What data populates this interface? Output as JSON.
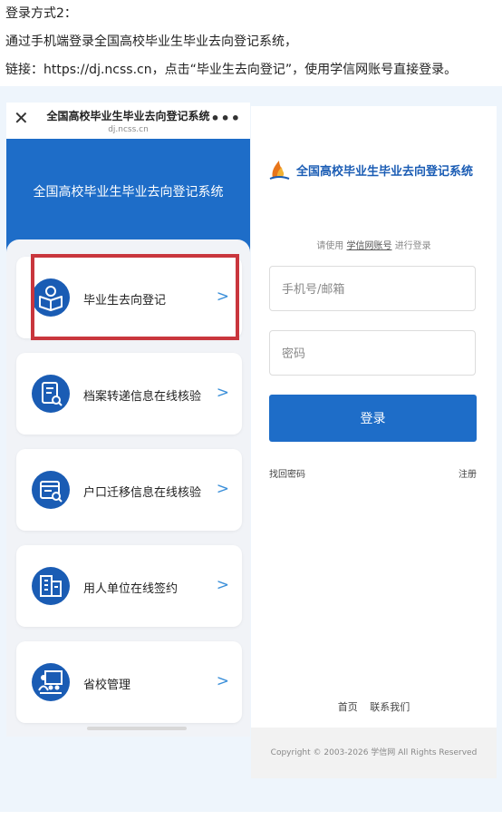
{
  "intro": {
    "line1": "登录方式2：",
    "line2": "通过手机端登录全国高校毕业生毕业去向登记系统，",
    "line3": "链接：https://dj.ncss.cn，点击“毕业生去向登记”，使用学信网账号直接登录。"
  },
  "left_phone": {
    "topbar": {
      "close_icon": "close-icon",
      "title": "全国高校毕业生毕业去向登记系统",
      "url": "dj.ncss.cn",
      "more_icon": "more-icon"
    },
    "hero_title": "全国高校毕业生毕业去向登记系统",
    "menu": [
      {
        "label": "毕业生去向登记",
        "icon": "book-reader-icon",
        "highlighted": true
      },
      {
        "label": "档案转递信息在线核验",
        "icon": "document-search-icon"
      },
      {
        "label": "户口迁移信息在线核验",
        "icon": "id-card-search-icon"
      },
      {
        "label": "用人单位在线签约",
        "icon": "building-icon"
      },
      {
        "label": "省校管理",
        "icon": "presenter-icon"
      }
    ],
    "arrow": ">",
    "colors": {
      "header": "#1e6dc8",
      "icon_bg": "#1a5cb4",
      "arrow": "#3a8fd9",
      "highlight": "#c9363d"
    }
  },
  "right_phone": {
    "title": "全国高校毕业生毕业去向登记系统",
    "hint_prefix": "请使用",
    "hint_link": "学信网账号",
    "hint_suffix": "进行登录",
    "phone_placeholder": "手机号/邮箱",
    "password_placeholder": "密码",
    "login_label": "登录",
    "forgot_label": "找回密码",
    "register_label": "注册",
    "footer_home": "首页",
    "footer_contact": "联系我们",
    "copyright": "Copyright © 2003-2026 学信网 All Rights Reserved",
    "colors": {
      "brand": "#1a5cb4",
      "button": "#1e6dc8"
    }
  }
}
